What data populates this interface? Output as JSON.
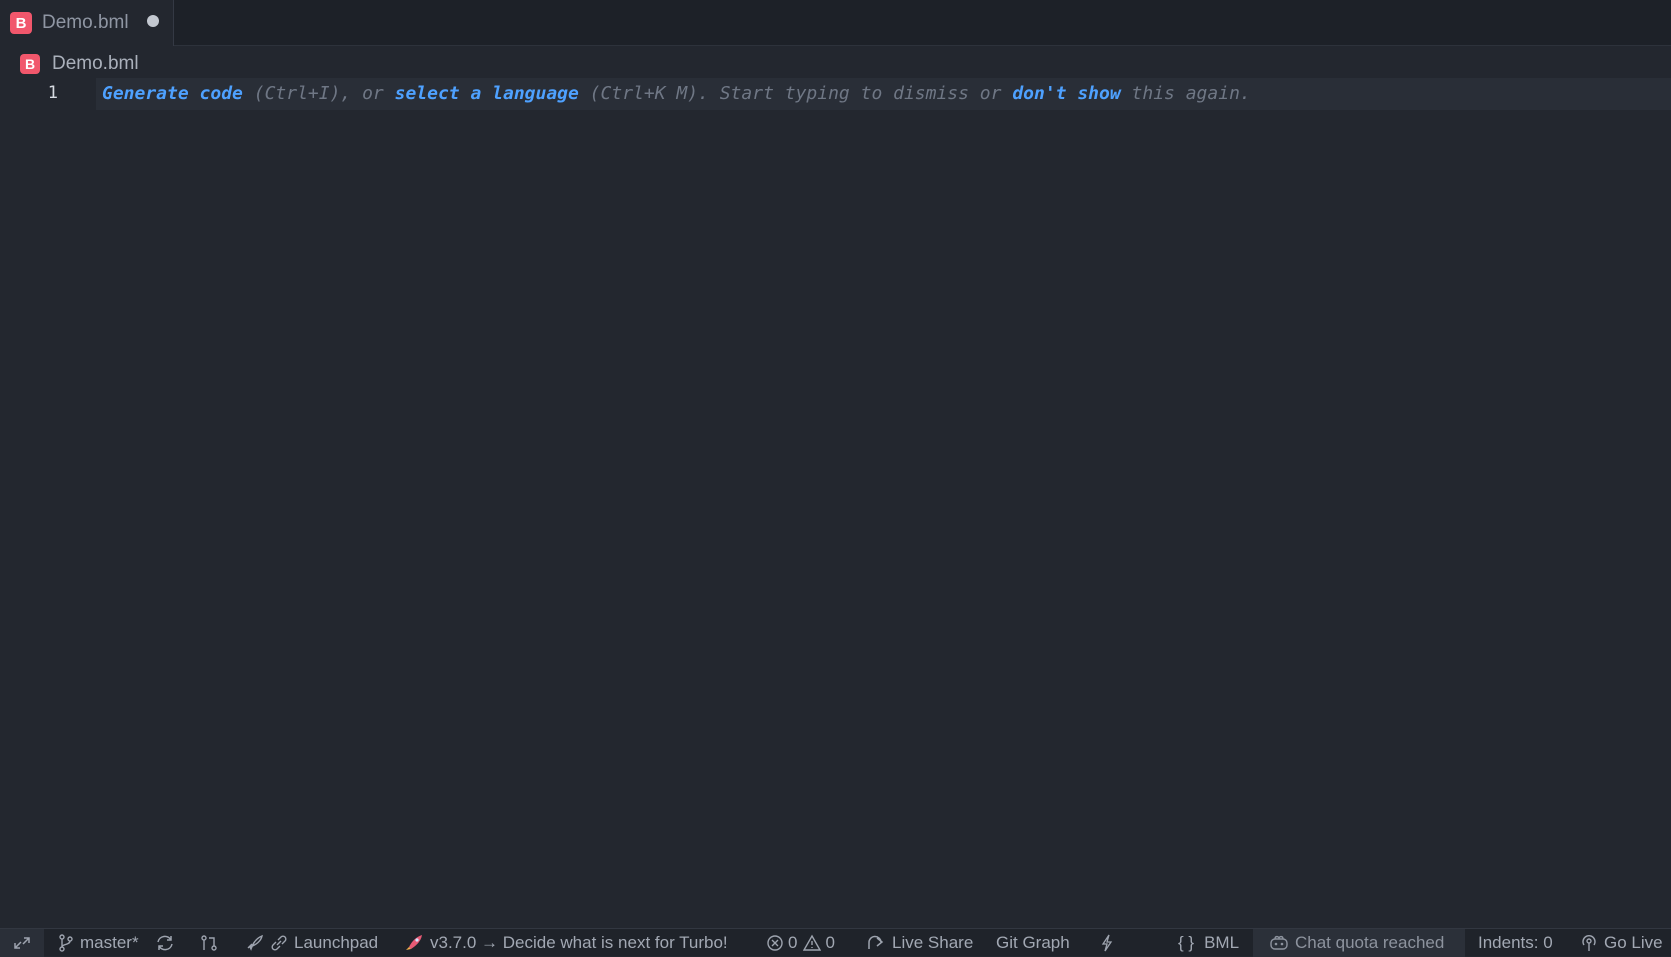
{
  "tab": {
    "icon_letter": "B",
    "label": "Demo.bml"
  },
  "breadcrumb": {
    "icon_letter": "B",
    "label": "Demo.bml"
  },
  "editor": {
    "line_number": "1",
    "hint": {
      "generate_code": "Generate code",
      "ctrl_i": " (Ctrl+I), or ",
      "select_language": "select a language",
      "ctrl_k_m": " (Ctrl+K M). Start typing to dismiss or ",
      "dont_show": "don't show",
      "this_again": " this again."
    }
  },
  "statusbar": {
    "branch": "master*",
    "launchpad": "Launchpad",
    "turbo": "v3.7.0 → Decide what is next for Turbo!",
    "errors": "0",
    "warnings": "0",
    "live_share": "Live Share",
    "git_graph": "Git Graph",
    "language_braces": "{ }",
    "language": "BML",
    "chat_quota": "Chat quota reached",
    "indents": "Indents: 0",
    "go_live": "Go Live"
  },
  "colors": {
    "accent_link": "#4ea1ff",
    "file_badge": "#f1576c",
    "editor_bg": "#23272f"
  }
}
